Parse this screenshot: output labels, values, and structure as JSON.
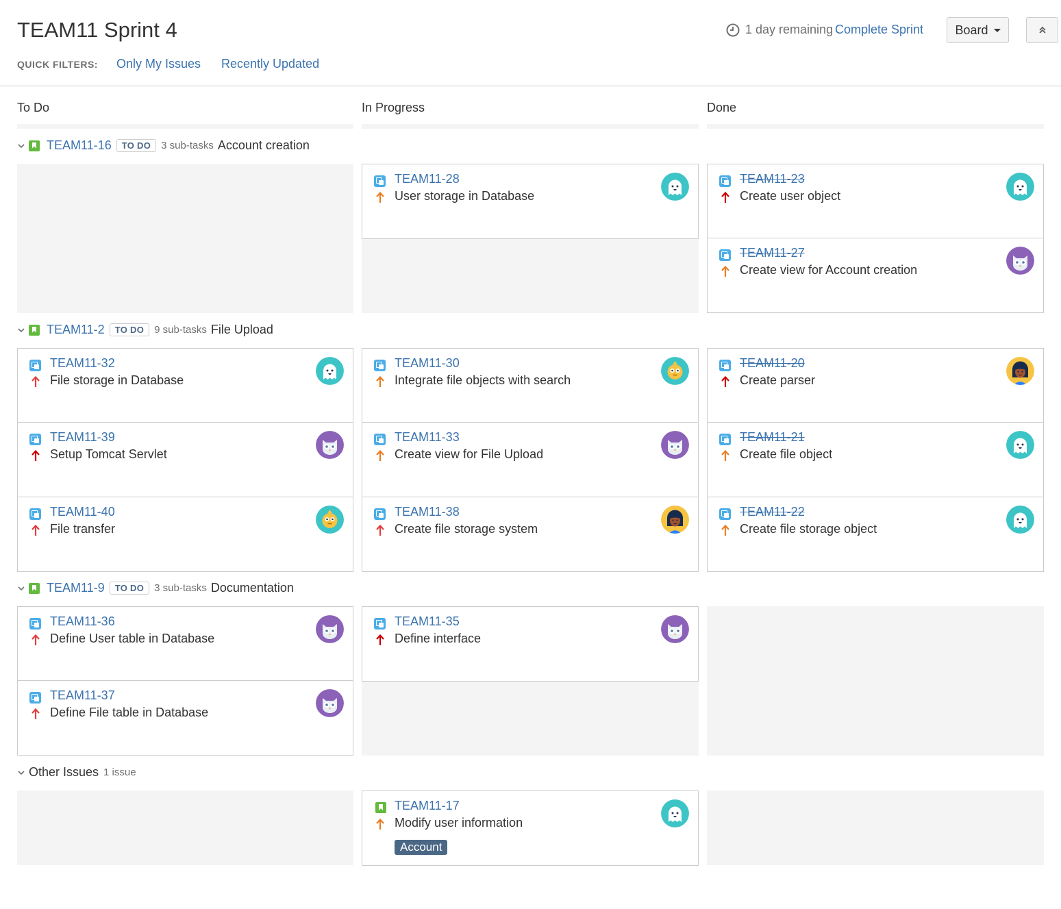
{
  "header": {
    "title": "TEAM11 Sprint 4",
    "remaining": "1 day remaining",
    "complete_sprint": "Complete Sprint",
    "board_label": "Board",
    "quick_filters_label": "QUICK FILTERS:",
    "quick_filters": [
      "Only My Issues",
      "Recently Updated"
    ]
  },
  "columns": [
    "To Do",
    "In Progress",
    "Done"
  ],
  "swimlanes": [
    {
      "key": "TEAM11-16",
      "status": "TO DO",
      "subtasks": "3 sub-tasks",
      "summary": "Account creation"
    },
    {
      "key": "TEAM11-2",
      "status": "TO DO",
      "subtasks": "9 sub-tasks",
      "summary": "File Upload"
    },
    {
      "key": "TEAM11-9",
      "status": "TO DO",
      "subtasks": "3 sub-tasks",
      "summary": "Documentation"
    }
  ],
  "other": {
    "label": "Other Issues",
    "count": "1 issue"
  },
  "cards": [
    {
      "key": "TEAM11-28",
      "summary": "User storage in Database",
      "priority": "medium",
      "avatar": "ghost-teal"
    },
    {
      "key": "TEAM11-23",
      "summary": "Create user object",
      "priority": "highest",
      "avatar": "ghost-teal"
    },
    {
      "key": "TEAM11-27",
      "summary": "Create view for Account creation",
      "priority": "medium",
      "avatar": "owl-purple"
    },
    {
      "key": "TEAM11-32",
      "summary": "File storage in Database",
      "priority": "high",
      "avatar": "ghost-teal"
    },
    {
      "key": "TEAM11-30",
      "summary": "Integrate file objects with search",
      "priority": "medium",
      "avatar": "yellow-teal"
    },
    {
      "key": "TEAM11-20",
      "summary": "Create parser",
      "priority": "highest",
      "avatar": "girl-yellow"
    },
    {
      "key": "TEAM11-39",
      "summary": "Setup Tomcat Servlet",
      "priority": "highest",
      "avatar": "owl-purple"
    },
    {
      "key": "TEAM11-33",
      "summary": "Create view for File Upload",
      "priority": "medium",
      "avatar": "owl-purple"
    },
    {
      "key": "TEAM11-21",
      "summary": "Create file object",
      "priority": "medium",
      "avatar": "ghost-teal"
    },
    {
      "key": "TEAM11-40",
      "summary": "File transfer",
      "priority": "high",
      "avatar": "yellow-teal"
    },
    {
      "key": "TEAM11-38",
      "summary": "Create file storage system",
      "priority": "high",
      "avatar": "girl-yellow"
    },
    {
      "key": "TEAM11-22",
      "summary": "Create file storage object",
      "priority": "medium",
      "avatar": "ghost-teal"
    },
    {
      "key": "TEAM11-36",
      "summary": "Define User table in Database",
      "priority": "high",
      "avatar": "owl-purple"
    },
    {
      "key": "TEAM11-35",
      "summary": "Define interface",
      "priority": "highest",
      "avatar": "owl-purple"
    },
    {
      "key": "TEAM11-37",
      "summary": "Define File table in Database",
      "priority": "high",
      "avatar": "owl-purple"
    },
    {
      "key": "TEAM11-17",
      "summary": "Modify user information",
      "priority": "medium",
      "avatar": "ghost-teal",
      "label": "Account"
    }
  ],
  "colors": {
    "link": "#3b73af",
    "priority_highest": "#cc0000",
    "priority_high": "#e03e3e",
    "priority_medium": "#ea7d24"
  }
}
